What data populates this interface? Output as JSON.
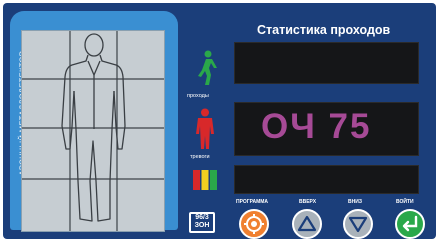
{
  "device": {
    "side_label": "АРОЧНЫЙ МЕТАЛЛОДЕТЕКТОР",
    "title": "Статистика проходов",
    "indicators": [
      {
        "name": "passages",
        "label": "проходы",
        "color": "#2aa84a",
        "icon": "walking-person-icon"
      },
      {
        "name": "alarms",
        "label": "тревоги",
        "color": "#d8282a",
        "icon": "standing-person-icon"
      },
      {
        "name": "zones",
        "label": "",
        "colors": [
          "#d8282a",
          "#f0d020",
          "#2aa84a"
        ],
        "icon": "zone-bars-icon"
      }
    ],
    "displays": {
      "top": "",
      "middle": "ОЧ 75",
      "bottom": ""
    },
    "logo_text": "96/3",
    "logo_subtext": "ЗОН",
    "buttons": [
      {
        "label": "ПРОГРАММА",
        "icon": "gear-icon",
        "color": "#f08030"
      },
      {
        "label": "ВВЕРХ",
        "icon": "up-triangle-icon",
        "color": "#a9b2ba"
      },
      {
        "label": "ВНИЗ",
        "icon": "down-triangle-icon",
        "color": "#a9b2ba"
      },
      {
        "label": "ВОЙТИ",
        "icon": "enter-icon",
        "color": "#2aa84a"
      }
    ]
  }
}
